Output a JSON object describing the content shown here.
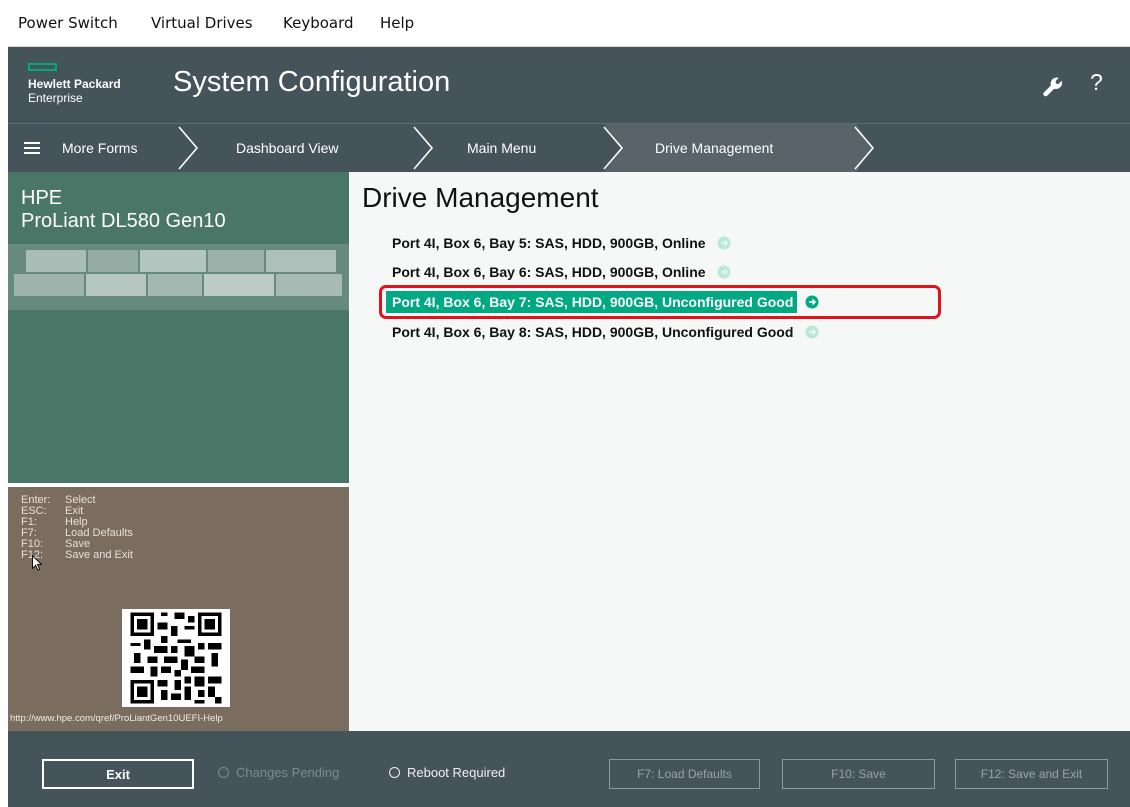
{
  "menubar": {
    "items": [
      "Power Switch",
      "Virtual Drives",
      "Keyboard",
      "Help"
    ]
  },
  "header": {
    "logo_line1": "Hewlett Packard",
    "logo_line2": "Enterprise",
    "title": "System Configuration",
    "help_glyph": "?",
    "icons": [
      "wrench-icon",
      "help-icon"
    ],
    "bg_color": "#45535a",
    "accent_color": "#01a982"
  },
  "nav": {
    "more_forms": "More Forms",
    "breadcrumbs": [
      "Dashboard View",
      "Main Menu",
      "Drive Management"
    ],
    "active_index": 2
  },
  "sidebar": {
    "brand": "HPE",
    "model": "ProLiant DL580 Gen10",
    "keys": [
      {
        "key": "Enter:",
        "action": "Select"
      },
      {
        "key": "ESC:",
        "action": "Exit"
      },
      {
        "key": "F1:",
        "action": "Help"
      },
      {
        "key": "F7:",
        "action": "Load Defaults"
      },
      {
        "key": "F10:",
        "action": "Save"
      },
      {
        "key": "F12:",
        "action": "Save and Exit"
      }
    ],
    "help_url": "http://www.hpe.com/qref/ProLiantGen10UEFI-Help"
  },
  "main": {
    "title": "Drive Management",
    "drives": [
      {
        "label": "Port 4I, Box 6, Bay 5: SAS, HDD, 900GB, Online",
        "selected": false
      },
      {
        "label": "Port 4I, Box 6, Bay 6: SAS, HDD, 900GB, Online",
        "selected": false
      },
      {
        "label": "Port 4I, Box 6, Bay 7: SAS, HDD, 900GB, Unconfigured Good",
        "selected": true
      },
      {
        "label": "Port 4I, Box 6, Bay 8: SAS, HDD, 900GB, Unconfigured Good",
        "selected": false
      }
    ],
    "selected_color": "#01a982",
    "highlight_color": "#e2121a"
  },
  "footer": {
    "exit_label": "Exit",
    "changes_pending": "Changes Pending",
    "reboot_required": "Reboot Required",
    "load_defaults_label": "F7: Load Defaults",
    "save_label": "F10: Save",
    "save_exit_label": "F12: Save and Exit"
  }
}
